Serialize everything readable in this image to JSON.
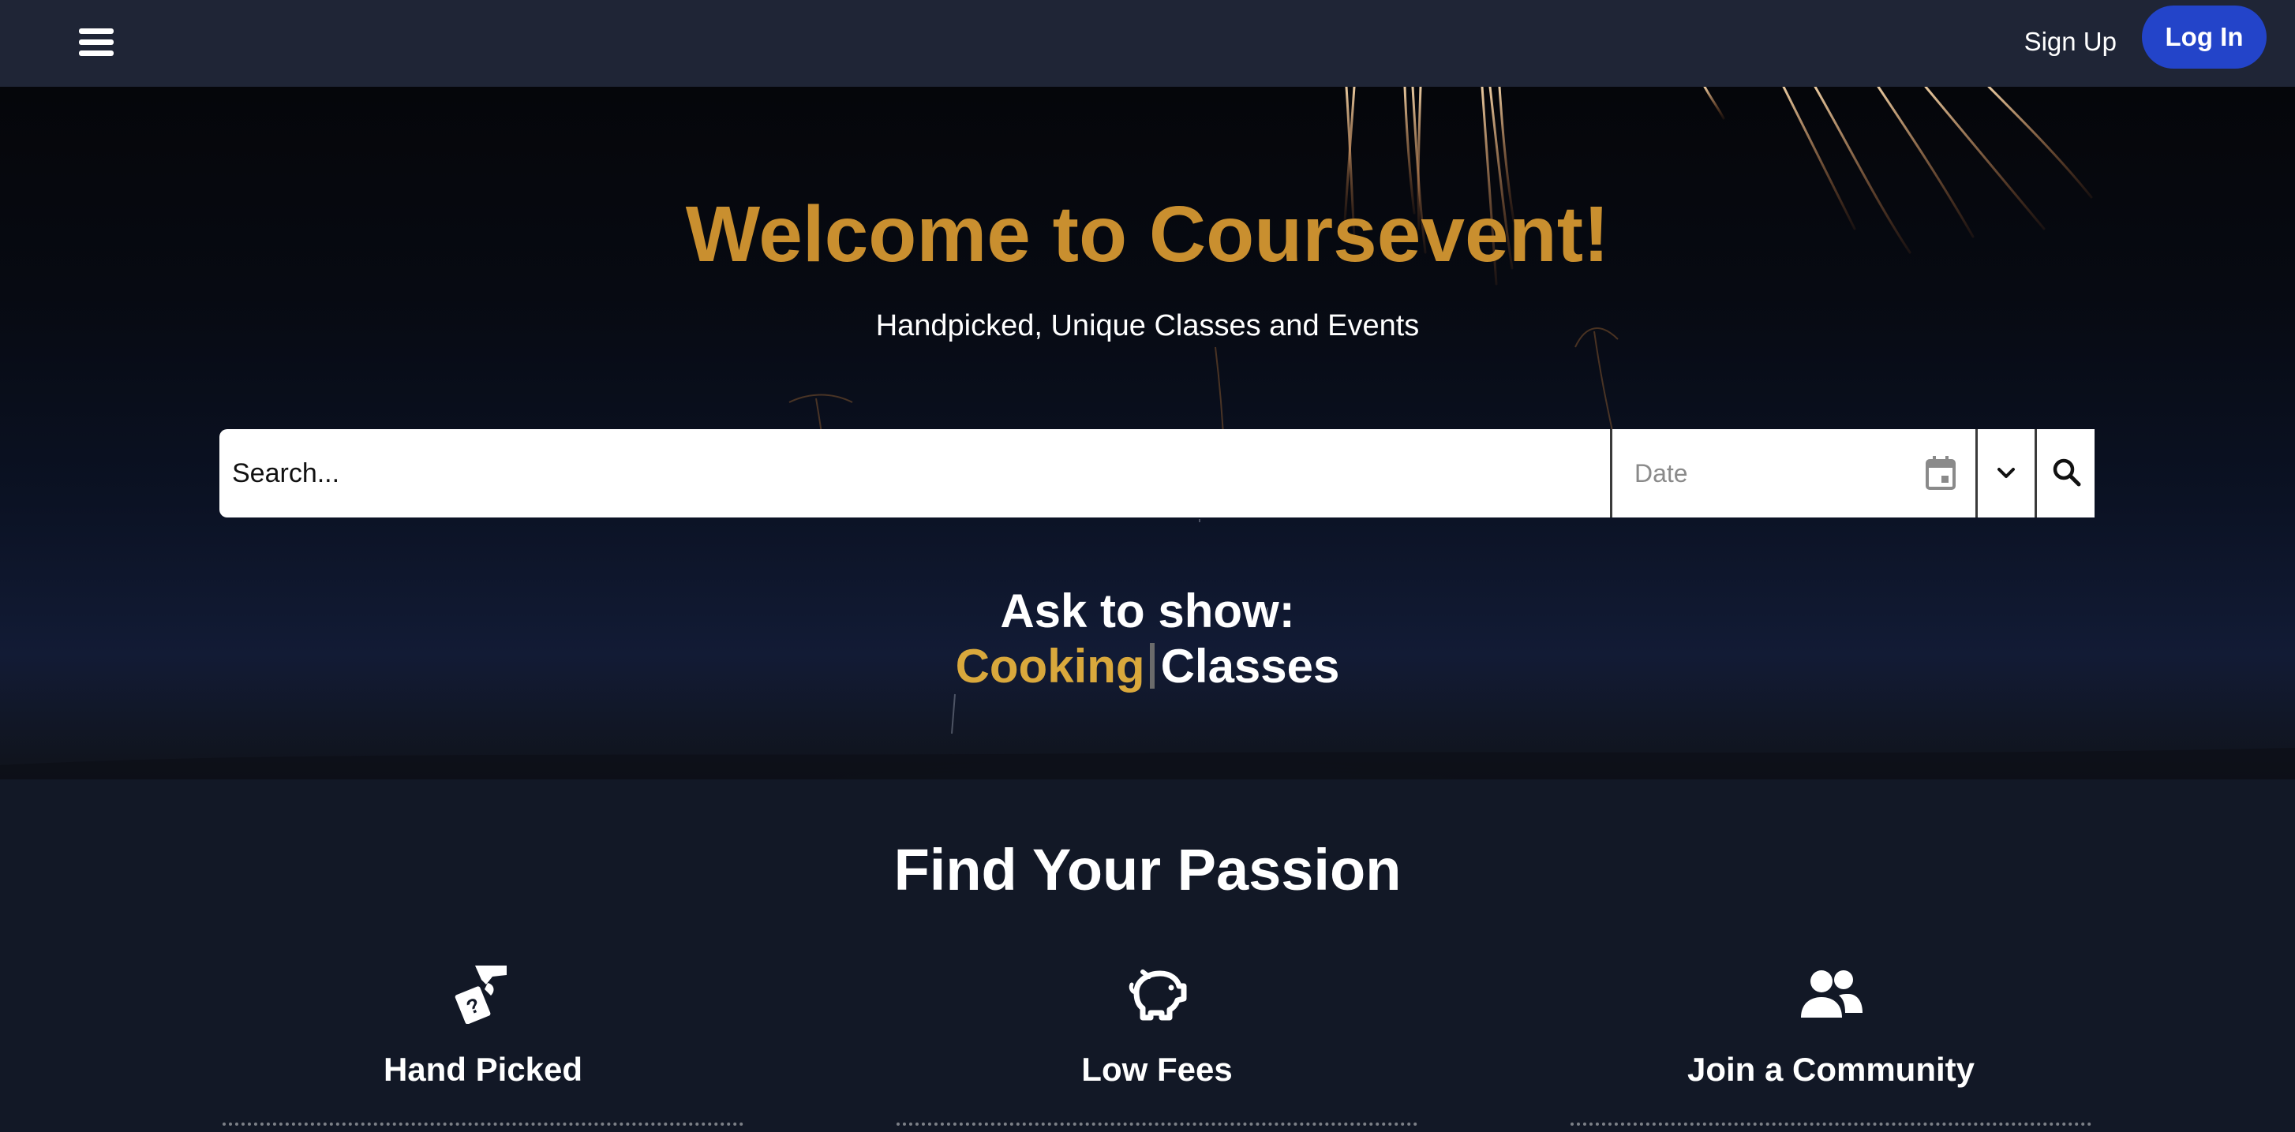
{
  "nav": {
    "menu_icon": "hamburger-menu-icon",
    "signup_label": "Sign Up",
    "login_label": "Log In",
    "login_color": "#2344c9"
  },
  "hero": {
    "title": "Welcome to Coursevent!",
    "subtitle": "Handpicked, Unique Classes and Events",
    "title_color": "#c98f2f",
    "search": {
      "placeholder": "Search...",
      "date_placeholder": "Date",
      "date_icon": "calendar-icon",
      "dropdown_icon": "chevron-down-icon",
      "submit_icon": "search-icon"
    },
    "ask_label": "Ask to show:",
    "ask_word": "Cooking",
    "ask_suffix": "Classes",
    "ask_word_color": "#d9a83c"
  },
  "features": {
    "title": "Find Your Passion",
    "items": [
      {
        "icon": "hand-holding-ticket-icon",
        "title": "Hand Picked"
      },
      {
        "icon": "piggy-bank-icon",
        "title": "Low Fees"
      },
      {
        "icon": "users-icon",
        "title": "Join a Community"
      }
    ]
  }
}
